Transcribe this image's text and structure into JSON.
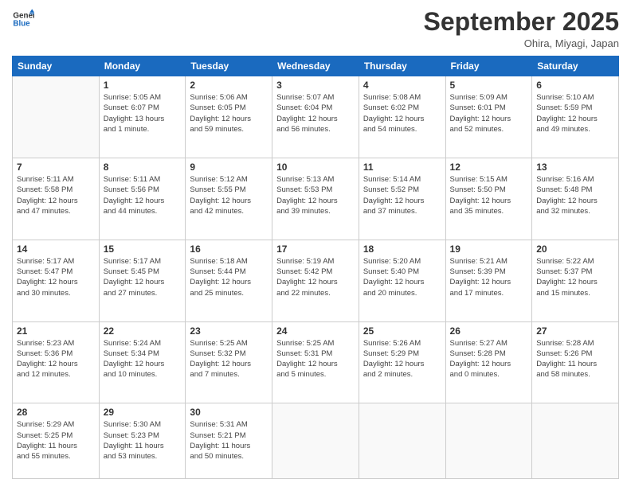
{
  "header": {
    "logo_line1": "General",
    "logo_line2": "Blue",
    "month": "September 2025",
    "location": "Ohira, Miyagi, Japan"
  },
  "weekdays": [
    "Sunday",
    "Monday",
    "Tuesday",
    "Wednesday",
    "Thursday",
    "Friday",
    "Saturday"
  ],
  "weeks": [
    [
      {
        "day": "",
        "info": ""
      },
      {
        "day": "1",
        "info": "Sunrise: 5:05 AM\nSunset: 6:07 PM\nDaylight: 13 hours\nand 1 minute."
      },
      {
        "day": "2",
        "info": "Sunrise: 5:06 AM\nSunset: 6:05 PM\nDaylight: 12 hours\nand 59 minutes."
      },
      {
        "day": "3",
        "info": "Sunrise: 5:07 AM\nSunset: 6:04 PM\nDaylight: 12 hours\nand 56 minutes."
      },
      {
        "day": "4",
        "info": "Sunrise: 5:08 AM\nSunset: 6:02 PM\nDaylight: 12 hours\nand 54 minutes."
      },
      {
        "day": "5",
        "info": "Sunrise: 5:09 AM\nSunset: 6:01 PM\nDaylight: 12 hours\nand 52 minutes."
      },
      {
        "day": "6",
        "info": "Sunrise: 5:10 AM\nSunset: 5:59 PM\nDaylight: 12 hours\nand 49 minutes."
      }
    ],
    [
      {
        "day": "7",
        "info": "Sunrise: 5:11 AM\nSunset: 5:58 PM\nDaylight: 12 hours\nand 47 minutes."
      },
      {
        "day": "8",
        "info": "Sunrise: 5:11 AM\nSunset: 5:56 PM\nDaylight: 12 hours\nand 44 minutes."
      },
      {
        "day": "9",
        "info": "Sunrise: 5:12 AM\nSunset: 5:55 PM\nDaylight: 12 hours\nand 42 minutes."
      },
      {
        "day": "10",
        "info": "Sunrise: 5:13 AM\nSunset: 5:53 PM\nDaylight: 12 hours\nand 39 minutes."
      },
      {
        "day": "11",
        "info": "Sunrise: 5:14 AM\nSunset: 5:52 PM\nDaylight: 12 hours\nand 37 minutes."
      },
      {
        "day": "12",
        "info": "Sunrise: 5:15 AM\nSunset: 5:50 PM\nDaylight: 12 hours\nand 35 minutes."
      },
      {
        "day": "13",
        "info": "Sunrise: 5:16 AM\nSunset: 5:48 PM\nDaylight: 12 hours\nand 32 minutes."
      }
    ],
    [
      {
        "day": "14",
        "info": "Sunrise: 5:17 AM\nSunset: 5:47 PM\nDaylight: 12 hours\nand 30 minutes."
      },
      {
        "day": "15",
        "info": "Sunrise: 5:17 AM\nSunset: 5:45 PM\nDaylight: 12 hours\nand 27 minutes."
      },
      {
        "day": "16",
        "info": "Sunrise: 5:18 AM\nSunset: 5:44 PM\nDaylight: 12 hours\nand 25 minutes."
      },
      {
        "day": "17",
        "info": "Sunrise: 5:19 AM\nSunset: 5:42 PM\nDaylight: 12 hours\nand 22 minutes."
      },
      {
        "day": "18",
        "info": "Sunrise: 5:20 AM\nSunset: 5:40 PM\nDaylight: 12 hours\nand 20 minutes."
      },
      {
        "day": "19",
        "info": "Sunrise: 5:21 AM\nSunset: 5:39 PM\nDaylight: 12 hours\nand 17 minutes."
      },
      {
        "day": "20",
        "info": "Sunrise: 5:22 AM\nSunset: 5:37 PM\nDaylight: 12 hours\nand 15 minutes."
      }
    ],
    [
      {
        "day": "21",
        "info": "Sunrise: 5:23 AM\nSunset: 5:36 PM\nDaylight: 12 hours\nand 12 minutes."
      },
      {
        "day": "22",
        "info": "Sunrise: 5:24 AM\nSunset: 5:34 PM\nDaylight: 12 hours\nand 10 minutes."
      },
      {
        "day": "23",
        "info": "Sunrise: 5:25 AM\nSunset: 5:32 PM\nDaylight: 12 hours\nand 7 minutes."
      },
      {
        "day": "24",
        "info": "Sunrise: 5:25 AM\nSunset: 5:31 PM\nDaylight: 12 hours\nand 5 minutes."
      },
      {
        "day": "25",
        "info": "Sunrise: 5:26 AM\nSunset: 5:29 PM\nDaylight: 12 hours\nand 2 minutes."
      },
      {
        "day": "26",
        "info": "Sunrise: 5:27 AM\nSunset: 5:28 PM\nDaylight: 12 hours\nand 0 minutes."
      },
      {
        "day": "27",
        "info": "Sunrise: 5:28 AM\nSunset: 5:26 PM\nDaylight: 11 hours\nand 58 minutes."
      }
    ],
    [
      {
        "day": "28",
        "info": "Sunrise: 5:29 AM\nSunset: 5:25 PM\nDaylight: 11 hours\nand 55 minutes."
      },
      {
        "day": "29",
        "info": "Sunrise: 5:30 AM\nSunset: 5:23 PM\nDaylight: 11 hours\nand 53 minutes."
      },
      {
        "day": "30",
        "info": "Sunrise: 5:31 AM\nSunset: 5:21 PM\nDaylight: 11 hours\nand 50 minutes."
      },
      {
        "day": "",
        "info": ""
      },
      {
        "day": "",
        "info": ""
      },
      {
        "day": "",
        "info": ""
      },
      {
        "day": "",
        "info": ""
      }
    ]
  ]
}
